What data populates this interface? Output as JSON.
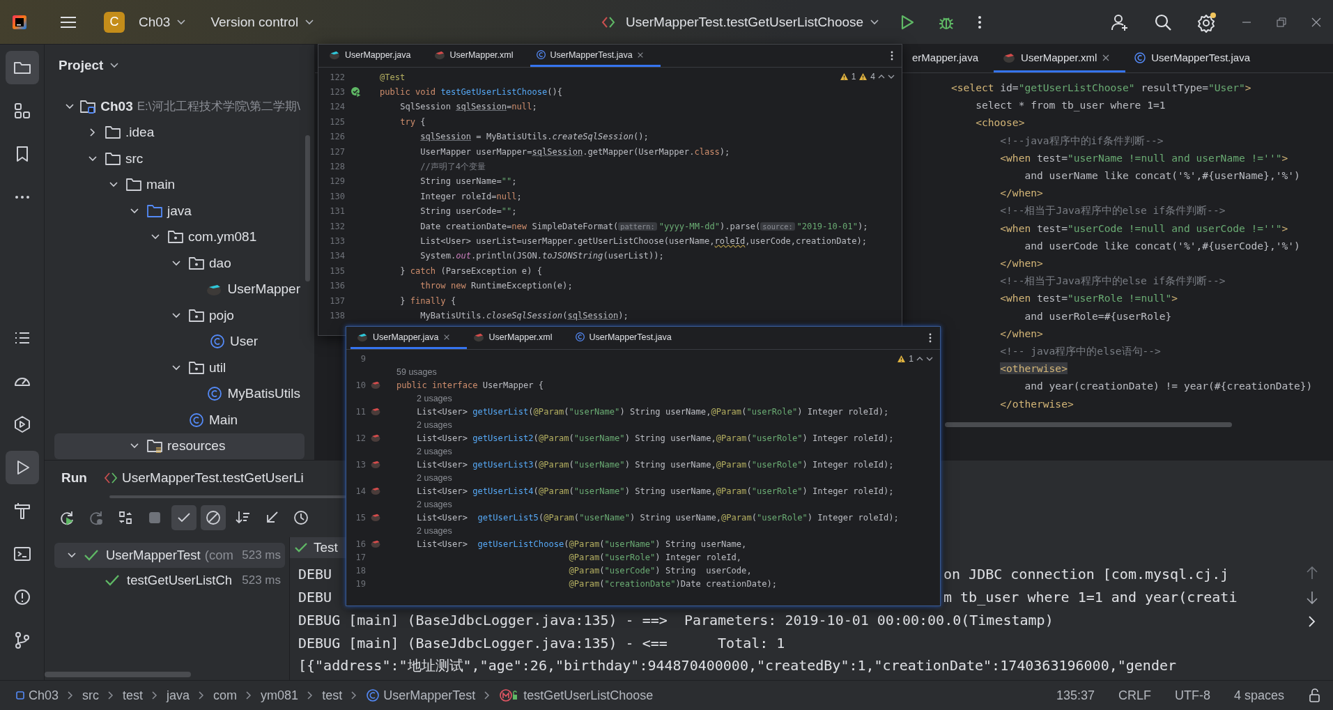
{
  "top_bar": {
    "project_badge": "C",
    "project": "Ch03",
    "vcs": "Version control",
    "run_config": "UserMapperTest.testGetUserListChoose"
  },
  "tool_strip_top": [
    {
      "kind": "project",
      "selected": true
    },
    {
      "kind": "structure",
      "selected": false
    },
    {
      "kind": "bookmarks",
      "selected": false
    },
    {
      "kind": "more",
      "selected": false
    }
  ],
  "tool_strip_bottom": [
    {
      "kind": "todo",
      "selected": false
    },
    {
      "kind": "profiler",
      "selected": false
    },
    {
      "kind": "services",
      "selected": false
    },
    {
      "kind": "run",
      "selected": true
    },
    {
      "kind": "build",
      "selected": false
    },
    {
      "kind": "terminal",
      "selected": false
    },
    {
      "kind": "problems",
      "selected": false
    },
    {
      "kind": "git",
      "selected": false
    }
  ],
  "project": {
    "title": "Project",
    "tree": [
      {
        "label": "Ch03",
        "path": "E:\\河北工程技术学院\\第二学期\\",
        "kind": "module",
        "expanded": true,
        "selected": false,
        "children": [
          {
            "label": ".idea",
            "kind": "folder",
            "expanded": false,
            "selected": false
          },
          {
            "label": "src",
            "kind": "folder",
            "expanded": true,
            "selected": false,
            "children": [
              {
                "label": "main",
                "kind": "folder",
                "expanded": true,
                "selected": false,
                "children": [
                  {
                    "label": "java",
                    "kind": "source-folder",
                    "expanded": true,
                    "selected": false,
                    "children": [
                      {
                        "label": "com.ym081",
                        "kind": "package",
                        "expanded": true,
                        "selected": false,
                        "children": [
                          {
                            "label": "dao",
                            "kind": "package",
                            "expanded": true,
                            "selected": false,
                            "children": [
                              {
                                "label": "UserMapper",
                                "kind": "mapper",
                                "selected": false
                              }
                            ]
                          },
                          {
                            "label": "pojo",
                            "kind": "package",
                            "expanded": true,
                            "selected": false,
                            "children": [
                              {
                                "label": "User",
                                "kind": "class",
                                "selected": false
                              }
                            ]
                          },
                          {
                            "label": "util",
                            "kind": "package",
                            "expanded": true,
                            "selected": false,
                            "children": [
                              {
                                "label": "MyBatisUtils",
                                "kind": "class",
                                "selected": false
                              }
                            ]
                          },
                          {
                            "label": "Main",
                            "kind": "class",
                            "selected": false
                          }
                        ]
                      }
                    ]
                  },
                  {
                    "label": "resources",
                    "kind": "resource-folder",
                    "expanded": true,
                    "selected": true
                  }
                ]
              }
            ]
          }
        ]
      }
    ]
  },
  "main_editor": {
    "tabs": [
      {
        "label": "erMapper.java",
        "selected": false
      },
      {
        "label": "UserMapper.xml",
        "kind": "xml-mapper",
        "selected": true
      },
      {
        "label": "UserMapperTest.java",
        "kind": "class",
        "selected": false
      }
    ],
    "lines": [
      [
        {
          "kind": "t",
          "text": "<select "
        },
        {
          "kind": "p",
          "text": "id="
        },
        {
          "kind": "s",
          "text": "\"getUserListChoose\""
        },
        {
          "kind": "p",
          "text": " resultType="
        },
        {
          "kind": "s",
          "text": "\"User\""
        },
        {
          "kind": "t",
          "text": ">"
        }
      ],
      [
        {
          "kind": "p",
          "text": "    select * from tb_user where 1=1"
        }
      ],
      [
        {
          "kind": "t",
          "text": "    <choose>"
        }
      ],
      [
        {
          "kind": "c",
          "text": "        <!--java程序中的if条件判断-->"
        }
      ],
      [
        {
          "kind": "t",
          "text": "        <when "
        },
        {
          "kind": "p",
          "text": "test="
        },
        {
          "kind": "s",
          "text": "\"userName !=null and userName !=''\""
        },
        {
          "kind": "t",
          "text": ">"
        }
      ],
      [
        {
          "kind": "p",
          "text": "            and userName like concat('%',#{userName},'%')"
        }
      ],
      [
        {
          "kind": "t",
          "text": "        </when>"
        }
      ],
      [
        {
          "kind": "c",
          "text": "        <!--相当于Java程序中的else if条件判断-->"
        }
      ],
      [
        {
          "kind": "t",
          "text": "        <when "
        },
        {
          "kind": "p",
          "text": "test="
        },
        {
          "kind": "s",
          "text": "\"userCode !=null and userCode !=''\""
        },
        {
          "kind": "t",
          "text": ">"
        }
      ],
      [
        {
          "kind": "p",
          "text": "            and userCode like concat('%',#{userCode},'%')"
        }
      ],
      [
        {
          "kind": "t",
          "text": "        </when>"
        }
      ],
      [
        {
          "kind": "c",
          "text": "        <!--相当于Java程序中的else if条件判断-->"
        }
      ],
      [
        {
          "kind": "t",
          "text": "        <when "
        },
        {
          "kind": "p",
          "text": "test="
        },
        {
          "kind": "s",
          "text": "\"userRole !=null\""
        },
        {
          "kind": "t",
          "text": ">"
        }
      ],
      [
        {
          "kind": "p",
          "text": "            and userRole=#{userRole}"
        }
      ],
      [
        {
          "kind": "t",
          "text": "        </when>"
        }
      ],
      [
        {
          "kind": "c",
          "text": "        <!-- java程序中的else语句-->"
        }
      ],
      [
        {
          "kind": "o",
          "text": "        <otherwise>"
        }
      ],
      [
        {
          "kind": "p",
          "text": "            and year(creationDate) != year(#{creationDate})"
        }
      ],
      [
        {
          "kind": "t",
          "text": "        </otherwise>"
        }
      ]
    ]
  },
  "floating_editors": [
    {
      "tabs": [
        {
          "label": "UserMapper.java",
          "kind": "java-mapper",
          "selected": false
        },
        {
          "label": "UserMapper.xml",
          "kind": "xml-mapper",
          "selected": false
        },
        {
          "label": "UserMapperTest.java",
          "kind": "class",
          "selected": true
        }
      ],
      "warnings": [
        "1",
        "4"
      ],
      "rows": [
        {
          "kind": "code",
          "no": "122",
          "segs": [
            {
              "kind": "a",
              "text": "@Test"
            }
          ]
        },
        {
          "kind": "run-code",
          "no": "123",
          "segs": [
            {
              "kind": "k",
              "text": "public void "
            },
            {
              "kind": "m",
              "text": "testGetUserListChoose"
            },
            {
              "kind": "p",
              "text": "(){"
            }
          ]
        },
        {
          "kind": "code",
          "no": "124",
          "segs": [
            {
              "kind": "p",
              "text": "    SqlSession "
            },
            {
              "kind": "u",
              "text": "sqlSession"
            },
            {
              "kind": "p",
              "text": "="
            },
            {
              "kind": "k",
              "text": "null"
            },
            {
              "kind": "p",
              "text": ";"
            }
          ]
        },
        {
          "kind": "code",
          "no": "125",
          "segs": [
            {
              "kind": "k",
              "text": "    try "
            },
            {
              "kind": "p",
              "text": "{"
            }
          ]
        },
        {
          "kind": "code",
          "no": "126",
          "segs": [
            {
              "kind": "u",
              "text": "        sqlSession"
            },
            {
              "kind": "p",
              "text": " = MyBatisUtils."
            },
            {
              "kind": "i",
              "text": "createSqlSession"
            },
            {
              "kind": "p",
              "text": "();"
            }
          ]
        },
        {
          "kind": "code",
          "no": "127",
          "segs": [
            {
              "kind": "p",
              "text": "        UserMapper userMapper="
            },
            {
              "kind": "u",
              "text": "sqlSession"
            },
            {
              "kind": "p",
              "text": ".getMapper(UserMapper."
            },
            {
              "kind": "k",
              "text": "class"
            },
            {
              "kind": "p",
              "text": ");"
            }
          ]
        },
        {
          "kind": "code",
          "no": "128",
          "segs": [
            {
              "kind": "c",
              "text": "        //声明了4个变量"
            }
          ]
        },
        {
          "kind": "code",
          "no": "129",
          "segs": [
            {
              "kind": "p",
              "text": "        String userName="
            },
            {
              "kind": "s",
              "text": "\"\""
            },
            {
              "kind": "p",
              "text": ";"
            }
          ]
        },
        {
          "kind": "code",
          "no": "130",
          "segs": [
            {
              "kind": "p",
              "text": "        Integer roleId="
            },
            {
              "kind": "k",
              "text": "null"
            },
            {
              "kind": "p",
              "text": ";"
            }
          ]
        },
        {
          "kind": "code",
          "no": "131",
          "segs": [
            {
              "kind": "p",
              "text": "        String userCode="
            },
            {
              "kind": "s",
              "text": "\"\""
            },
            {
              "kind": "p",
              "text": ";"
            }
          ]
        },
        {
          "kind": "code",
          "no": "132",
          "segs": [
            {
              "kind": "p",
              "text": "        Date creationDate="
            },
            {
              "kind": "k",
              "text": "new "
            },
            {
              "kind": "p",
              "text": "SimpleDateFormat("
            },
            {
              "kind": "h",
              "text": "pattern:"
            },
            {
              "kind": "s",
              "text": "\"yyyy-MM-dd\""
            },
            {
              "kind": "p",
              "text": ").parse("
            },
            {
              "kind": "h",
              "text": "source:"
            },
            {
              "kind": "s",
              "text": "\"2019-10-01\""
            },
            {
              "kind": "p",
              "text": ");"
            }
          ]
        },
        {
          "kind": "code",
          "no": "133",
          "segs": [
            {
              "kind": "p",
              "text": "        List<User> userList=userMapper.getUserListChoose(userName,"
            },
            {
              "kind": "w",
              "text": "roleId"
            },
            {
              "kind": "p",
              "text": ",userCode,creationDate);"
            }
          ]
        },
        {
          "kind": "code",
          "no": "134",
          "segs": [
            {
              "kind": "p",
              "text": "        System."
            },
            {
              "kind": "f",
              "text": "out"
            },
            {
              "kind": "p",
              "text": ".println(JSON."
            },
            {
              "kind": "i",
              "text": "toJSONString"
            },
            {
              "kind": "p",
              "text": "(userList));"
            }
          ]
        },
        {
          "kind": "code",
          "no": "135",
          "segs": [
            {
              "kind": "p",
              "text": "    } "
            },
            {
              "kind": "k",
              "text": "catch "
            },
            {
              "kind": "p",
              "text": "(ParseException e) {"
            }
          ]
        },
        {
          "kind": "code",
          "no": "136",
          "segs": [
            {
              "kind": "k",
              "text": "        throw new "
            },
            {
              "kind": "p",
              "text": "RuntimeException(e);"
            }
          ]
        },
        {
          "kind": "code",
          "no": "137",
          "segs": [
            {
              "kind": "p",
              "text": "    } "
            },
            {
              "kind": "k",
              "text": "finally "
            },
            {
              "kind": "p",
              "text": "{"
            }
          ]
        },
        {
          "kind": "code",
          "no": "138",
          "segs": [
            {
              "kind": "p",
              "text": "        MyBatisUtils."
            },
            {
              "kind": "i",
              "text": "closeSqlSession"
            },
            {
              "kind": "p",
              "text": "("
            },
            {
              "kind": "u",
              "text": "sqlSession"
            },
            {
              "kind": "p",
              "text": ");"
            }
          ]
        }
      ]
    },
    {
      "tabs": [
        {
          "label": "UserMapper.java",
          "kind": "java-mapper",
          "selected": true
        },
        {
          "label": "UserMapper.xml",
          "kind": "xml-mapper",
          "selected": false
        },
        {
          "label": "UserMapperTest.java",
          "kind": "class",
          "selected": false
        }
      ],
      "warnings": [
        "1"
      ],
      "rows": [
        {
          "kind": "code",
          "no": "9"
        },
        {
          "kind": "usages",
          "text": "59 usages"
        },
        {
          "kind": "mapper-code",
          "no": "10",
          "segs": [
            {
              "kind": "k",
              "text": "public interface "
            },
            {
              "kind": "p",
              "text": "UserMapper {"
            }
          ]
        },
        {
          "kind": "member-usages",
          "text": "2 usages"
        },
        {
          "kind": "mapper-code",
          "no": "11",
          "segs": [
            {
              "kind": "p",
              "text": "    List<User> "
            },
            {
              "kind": "m",
              "text": "getUserList"
            },
            {
              "kind": "p",
              "text": "("
            },
            {
              "kind": "a",
              "text": "@Param"
            },
            {
              "kind": "p",
              "text": "("
            },
            {
              "kind": "s",
              "text": "\"userName\""
            },
            {
              "kind": "p",
              "text": ") String userName,"
            },
            {
              "kind": "a",
              "text": "@Param"
            },
            {
              "kind": "p",
              "text": "("
            },
            {
              "kind": "s",
              "text": "\"userRole\""
            },
            {
              "kind": "p",
              "text": ") Integer roleId);"
            }
          ]
        },
        {
          "kind": "member-usages",
          "text": "2 usages"
        },
        {
          "kind": "mapper-code",
          "no": "12",
          "segs": [
            {
              "kind": "p",
              "text": "    List<User> "
            },
            {
              "kind": "m",
              "text": "getUserList2"
            },
            {
              "kind": "p",
              "text": "("
            },
            {
              "kind": "a",
              "text": "@Param"
            },
            {
              "kind": "p",
              "text": "("
            },
            {
              "kind": "s",
              "text": "\"userName\""
            },
            {
              "kind": "p",
              "text": ") String userName,"
            },
            {
              "kind": "a",
              "text": "@Param"
            },
            {
              "kind": "p",
              "text": "("
            },
            {
              "kind": "s",
              "text": "\"userRole\""
            },
            {
              "kind": "p",
              "text": ") Integer roleId);"
            }
          ]
        },
        {
          "kind": "member-usages",
          "text": "2 usages"
        },
        {
          "kind": "mapper-code",
          "no": "13",
          "segs": [
            {
              "kind": "p",
              "text": "    List<User> "
            },
            {
              "kind": "m",
              "text": "getUserList3"
            },
            {
              "kind": "p",
              "text": "("
            },
            {
              "kind": "a",
              "text": "@Param"
            },
            {
              "kind": "p",
              "text": "("
            },
            {
              "kind": "s",
              "text": "\"userName\""
            },
            {
              "kind": "p",
              "text": ") String userName,"
            },
            {
              "kind": "a",
              "text": "@Param"
            },
            {
              "kind": "p",
              "text": "("
            },
            {
              "kind": "s",
              "text": "\"userRole\""
            },
            {
              "kind": "p",
              "text": ") Integer roleId);"
            }
          ]
        },
        {
          "kind": "member-usages",
          "text": "2 usages"
        },
        {
          "kind": "mapper-code",
          "no": "14",
          "segs": [
            {
              "kind": "p",
              "text": "    List<User> "
            },
            {
              "kind": "m",
              "text": "getUserList4"
            },
            {
              "kind": "p",
              "text": "("
            },
            {
              "kind": "a",
              "text": "@Param"
            },
            {
              "kind": "p",
              "text": "("
            },
            {
              "kind": "s",
              "text": "\"userName\""
            },
            {
              "kind": "p",
              "text": ") String userName,"
            },
            {
              "kind": "a",
              "text": "@Param"
            },
            {
              "kind": "p",
              "text": "("
            },
            {
              "kind": "s",
              "text": "\"userRole\""
            },
            {
              "kind": "p",
              "text": ") Integer roleId);"
            }
          ]
        },
        {
          "kind": "member-usages",
          "text": "2 usages"
        },
        {
          "kind": "mapper-code",
          "no": "15",
          "segs": [
            {
              "kind": "p",
              "text": "    List<User>  "
            },
            {
              "kind": "m",
              "text": "getUserList5"
            },
            {
              "kind": "p",
              "text": "("
            },
            {
              "kind": "a",
              "text": "@Param"
            },
            {
              "kind": "p",
              "text": "("
            },
            {
              "kind": "s",
              "text": "\"userName\""
            },
            {
              "kind": "p",
              "text": ") String userName,"
            },
            {
              "kind": "a",
              "text": "@Param"
            },
            {
              "kind": "p",
              "text": "("
            },
            {
              "kind": "s",
              "text": "\"userRole\""
            },
            {
              "kind": "p",
              "text": ") Integer roleId);"
            }
          ]
        },
        {
          "kind": "member-usages",
          "text": "2 usages"
        },
        {
          "kind": "mapper-code",
          "no": "16",
          "segs": [
            {
              "kind": "p",
              "text": "    List<User>  "
            },
            {
              "kind": "m",
              "text": "getUserListChoose"
            },
            {
              "kind": "p",
              "text": "("
            },
            {
              "kind": "a",
              "text": "@Param"
            },
            {
              "kind": "p",
              "text": "("
            },
            {
              "kind": "s",
              "text": "\"userName\""
            },
            {
              "kind": "p",
              "text": ") String userName,"
            }
          ]
        },
        {
          "kind": "code",
          "no": "17",
          "segs": [
            {
              "kind": "a",
              "text": "                                  @Param"
            },
            {
              "kind": "p",
              "text": "("
            },
            {
              "kind": "s",
              "text": "\"userRole\""
            },
            {
              "kind": "p",
              "text": ") Integer roleId,"
            }
          ]
        },
        {
          "kind": "code",
          "no": "18",
          "segs": [
            {
              "kind": "a",
              "text": "                                  @Param"
            },
            {
              "kind": "p",
              "text": "("
            },
            {
              "kind": "s",
              "text": "\"userCode\""
            },
            {
              "kind": "p",
              "text": ") String  userCode,"
            }
          ]
        },
        {
          "kind": "code",
          "no": "19",
          "segs": [
            {
              "kind": "a",
              "text": "                                  @Param"
            },
            {
              "kind": "p",
              "text": "("
            },
            {
              "kind": "s",
              "text": "\"creationDate\""
            },
            {
              "kind": "p",
              "text": ")Date creationDate);"
            }
          ]
        }
      ]
    }
  ],
  "run": {
    "title": "Run",
    "tab": "UserMapperTest.testGetUserLi",
    "toolbar": [
      {
        "kind": "rerun",
        "selected": false,
        "disabled": false
      },
      {
        "kind": "rerun-failed",
        "selected": false,
        "disabled": true
      },
      {
        "kind": "toggle",
        "selected": false,
        "disabled": false
      },
      {
        "kind": "stop",
        "selected": false,
        "disabled": true
      },
      {
        "kind": "show-passed",
        "selected": true,
        "disabled": false
      },
      {
        "kind": "show-ignored",
        "selected": true,
        "disabled": false
      },
      {
        "kind": "sort",
        "selected": false,
        "disabled": false
      },
      {
        "kind": "import",
        "selected": false,
        "disabled": false
      },
      {
        "kind": "history",
        "selected": false,
        "disabled": false
      }
    ],
    "tests": [
      {
        "name": "UserMapperTest",
        "detail": "(com",
        "time": "523 ms",
        "passed": true,
        "selected": true,
        "expanded": true,
        "children": [
          {
            "name": "testGetUserListCh",
            "time": "523 ms",
            "passed": true,
            "selected": false
          }
        ]
      }
    ],
    "console_header": "Test",
    "console": [
      {
        "kind": "split",
        "left": "DEBU",
        "right": "on JDBC connection [com.mysql.cj.j"
      },
      {
        "kind": "split",
        "left": "DEBU",
        "right": "m tb_user where 1=1 and year(creati"
      },
      {
        "kind": "full",
        "text": "DEBUG [main] (BaseJdbcLogger.java:135) - ==>  Parameters: 2019-10-01 00:00:00.0(Timestamp)"
      },
      {
        "kind": "full",
        "text": "DEBUG [main] (BaseJdbcLogger.java:135) - <==      Total: 1"
      },
      {
        "kind": "full",
        "text": "[{\"address\":\"地址测试\",\"age\":26,\"birthday\":944870400000,\"createdBy\":1,\"creationDate\":1740363196000,\"gender"
      }
    ]
  },
  "status_bar": {
    "breadcrumbs": [
      {
        "label": "Ch03",
        "kind": "module"
      },
      {
        "label": "src"
      },
      {
        "label": "test"
      },
      {
        "label": "java"
      },
      {
        "label": "com"
      },
      {
        "label": "ym081"
      },
      {
        "label": "test"
      },
      {
        "label": "UserMapperTest",
        "kind": "class"
      },
      {
        "label": "testGetUserListChoose",
        "kind": "method"
      }
    ],
    "position": "135:37",
    "line_ending": "CRLF",
    "encoding": "UTF-8",
    "indent": "4 spaces"
  }
}
